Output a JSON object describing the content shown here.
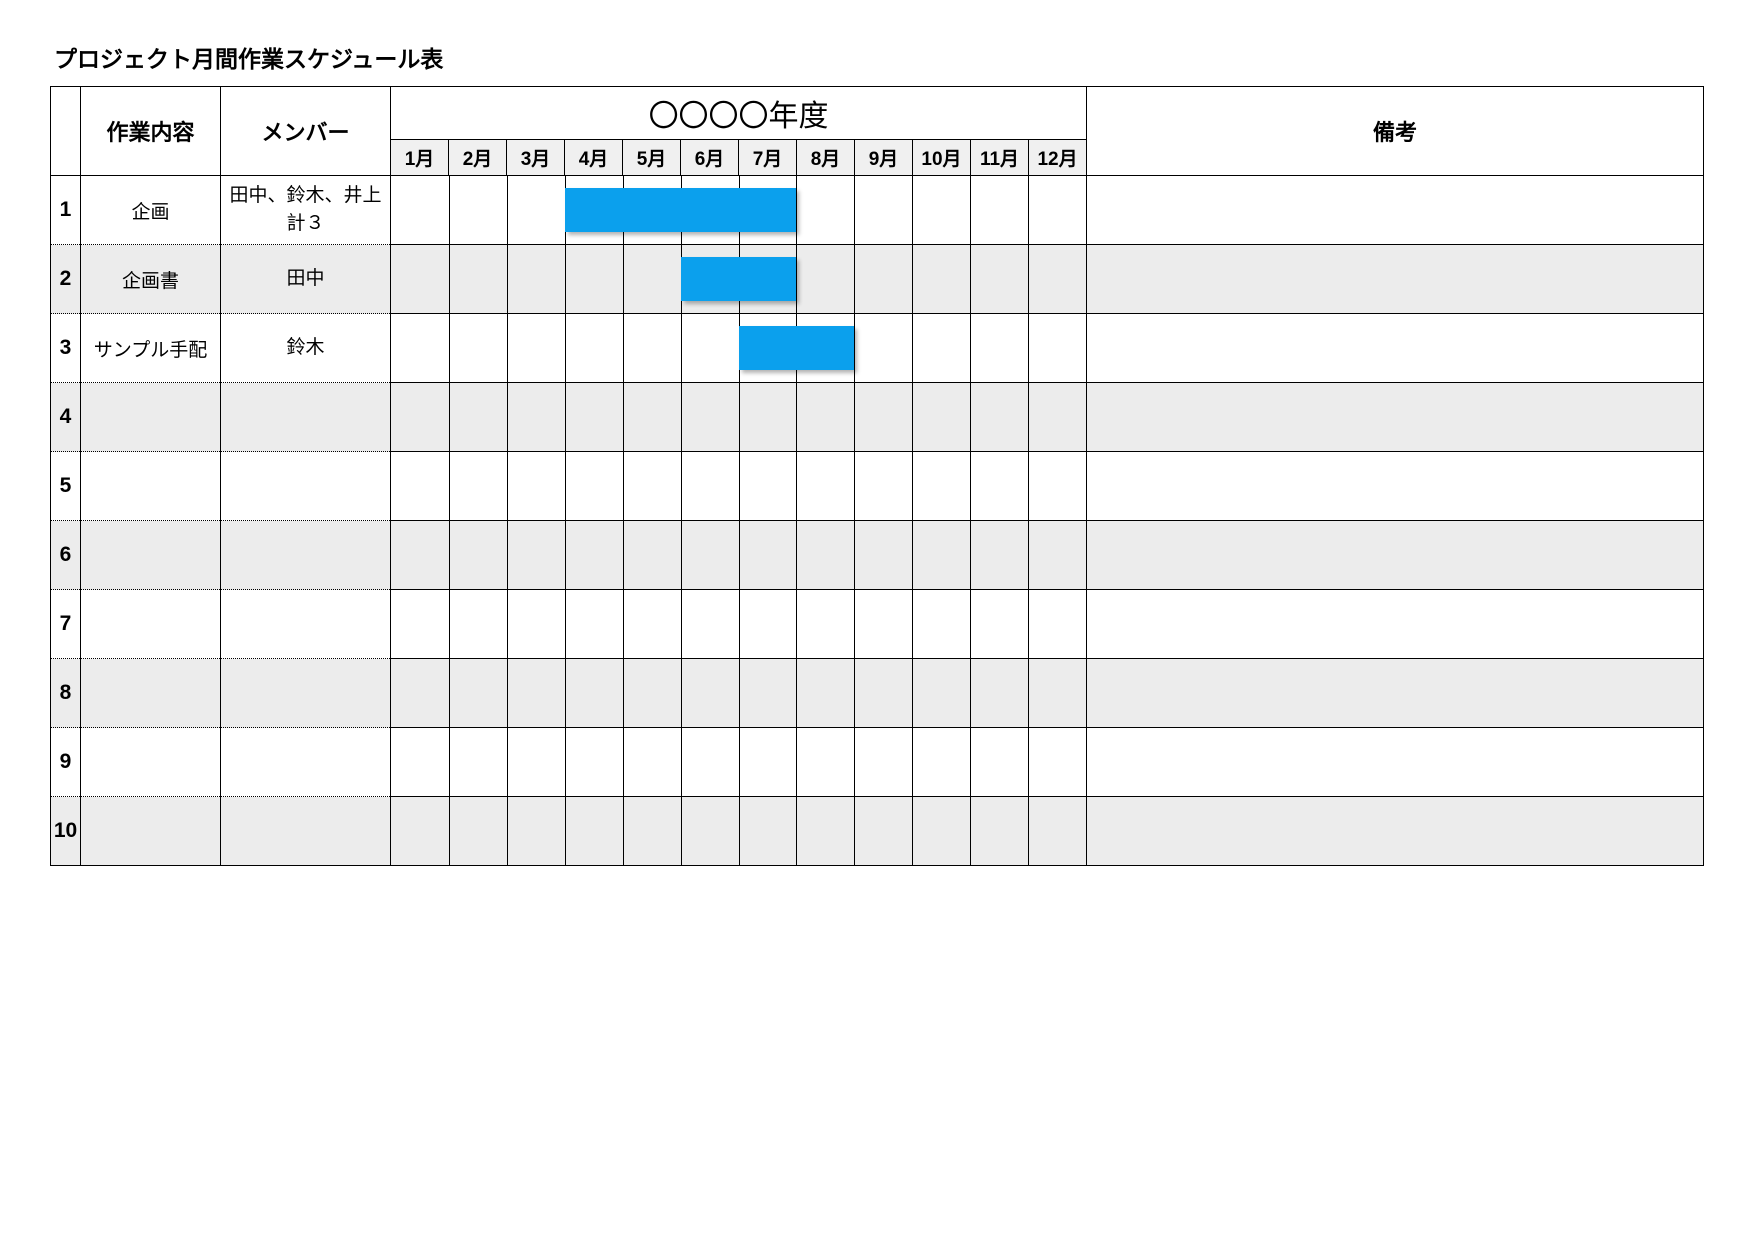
{
  "title": "プロジェクト月間作業スケジュール表",
  "header": {
    "task": "作業内容",
    "member": "メンバー",
    "year": "〇〇〇〇年度",
    "notes": "備考",
    "months": [
      "1月",
      "2月",
      "3月",
      "4月",
      "5月",
      "6月",
      "7月",
      "8月",
      "9月",
      "10月",
      "11月",
      "12月"
    ]
  },
  "chart_data": {
    "type": "bar",
    "title": "プロジェクト月間作業スケジュール表",
    "xlabel": "月",
    "ylabel": "作業内容",
    "x_range": [
      1,
      12
    ],
    "categories": [
      "企画",
      "企画書",
      "サンプル手配",
      "",
      "",
      "",
      "",
      "",
      "",
      ""
    ],
    "series": [
      {
        "name": "企画",
        "member": "田中、鈴木、井上　計３",
        "start": 4,
        "end": 7,
        "notes": ""
      },
      {
        "name": "企画書",
        "member": "田中",
        "start": 6,
        "end": 7,
        "notes": ""
      },
      {
        "name": "サンプル手配",
        "member": "鈴木",
        "start": 7,
        "end": 8,
        "notes": ""
      },
      {
        "name": "",
        "member": "",
        "start": null,
        "end": null,
        "notes": ""
      },
      {
        "name": "",
        "member": "",
        "start": null,
        "end": null,
        "notes": ""
      },
      {
        "name": "",
        "member": "",
        "start": null,
        "end": null,
        "notes": ""
      },
      {
        "name": "",
        "member": "",
        "start": null,
        "end": null,
        "notes": ""
      },
      {
        "name": "",
        "member": "",
        "start": null,
        "end": null,
        "notes": ""
      },
      {
        "name": "",
        "member": "",
        "start": null,
        "end": null,
        "notes": ""
      },
      {
        "name": "",
        "member": "",
        "start": null,
        "end": null,
        "notes": ""
      }
    ]
  },
  "colors": {
    "bar": "#0ba0ed",
    "alt_row": "#ececec",
    "month_bg": "#f0f0f0"
  }
}
